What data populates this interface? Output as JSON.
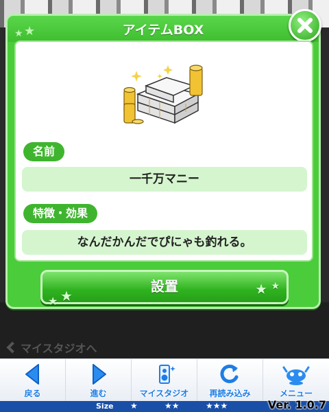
{
  "dialog": {
    "title": "アイテムBOX",
    "name_label": "名前",
    "name_value": "一千万マニー",
    "feature_label": "特徴・効果",
    "feature_value": "なんだかんだでぴにゃも釣れる。",
    "install_label": "設置"
  },
  "background": {
    "back_link": "マイスタジオへ"
  },
  "nav": {
    "items": [
      {
        "label": "戻る",
        "icon": "back-arrow-icon"
      },
      {
        "label": "進む",
        "icon": "forward-arrow-icon"
      },
      {
        "label": "マイスタジオ",
        "icon": "studio-icon"
      },
      {
        "label": "再読み込み",
        "icon": "reload-icon"
      },
      {
        "label": "メニュー",
        "icon": "menu-mascot-icon"
      }
    ]
  },
  "statusbar": {
    "size_label": "Size",
    "size_small": "★",
    "size_medium": "★★",
    "size_large": "★★★",
    "version": "Ver. 1.0.7"
  },
  "colors": {
    "dialog_green": "#4bcc3a",
    "label_green": "#3fb52f",
    "value_bg": "#d5f5cf",
    "nav_blue": "#1d7de6",
    "status_blue": "#1a4fa8"
  }
}
